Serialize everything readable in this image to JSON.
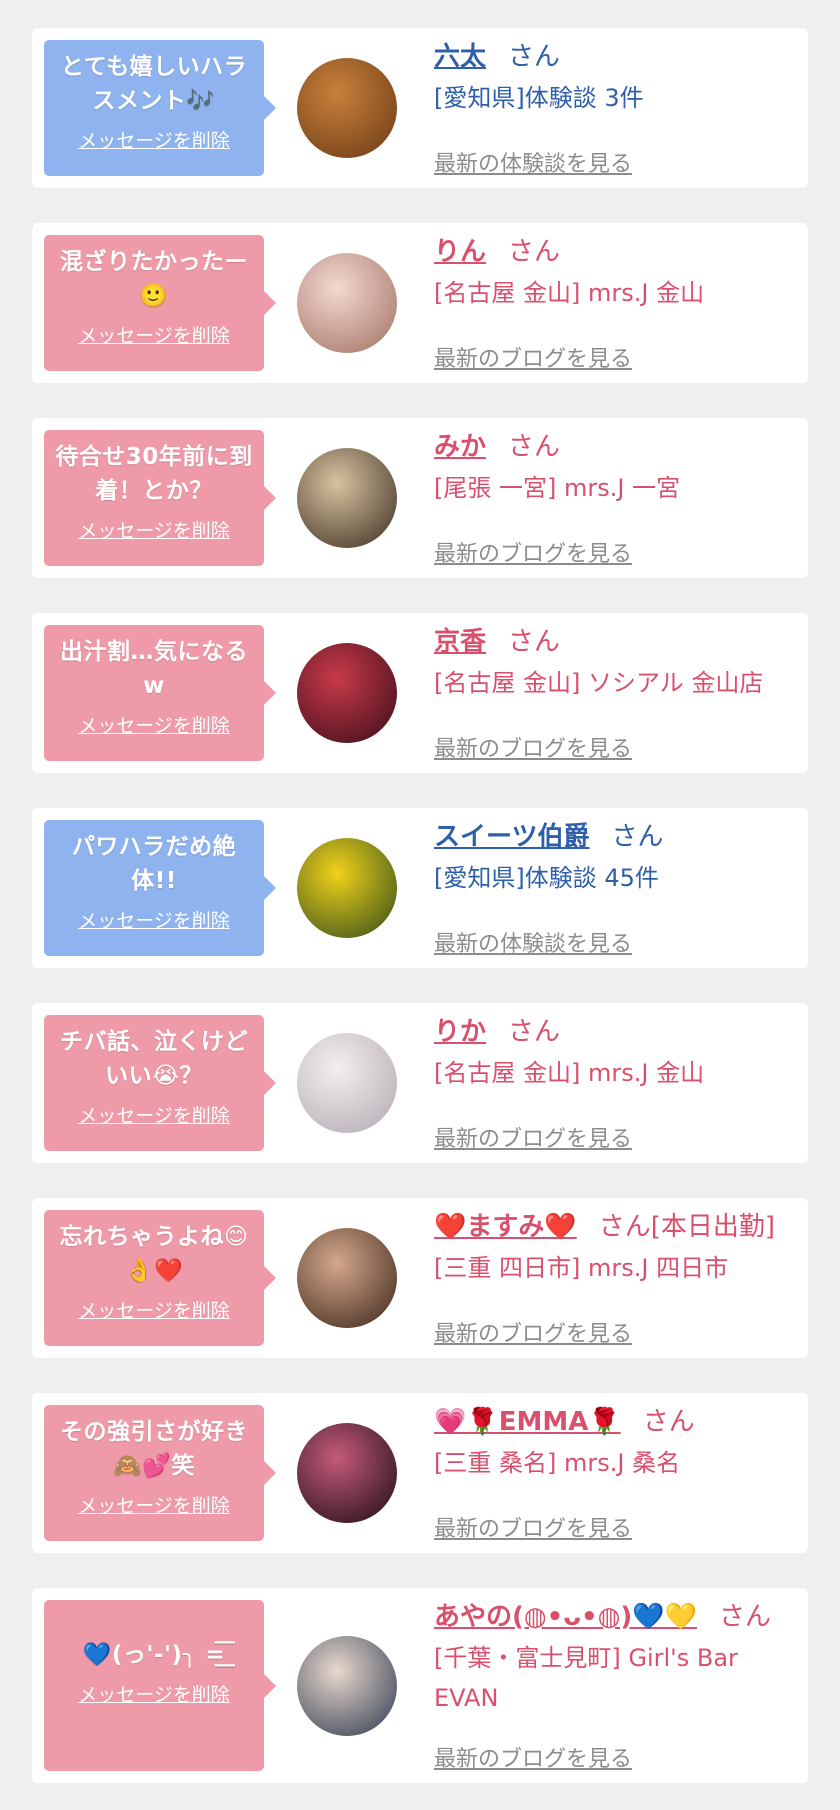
{
  "delete_label": "メッセージを削除",
  "san": "さん",
  "cards": [
    {
      "msg": "とても嬉しいハラスメント🎶",
      "name": "六太",
      "suffix": "",
      "sub": "[愛知県]体験談 3件",
      "latest": "最新の体験談を見る",
      "theme": "blue",
      "avatar_colors": [
        "#c9803b",
        "#6a3a15"
      ]
    },
    {
      "msg": "混ざりたかったー🙂",
      "name": "りん",
      "suffix": "",
      "sub": "[名古屋 金山] mrs.J 金山",
      "latest": "最新のブログを見る",
      "theme": "pink",
      "avatar_colors": [
        "#f4d8d2",
        "#a07060"
      ]
    },
    {
      "msg": "待合せ30年前に到着！とか？",
      "name": "みか",
      "suffix": "",
      "sub": "[尾張 一宮] mrs.J 一宮",
      "latest": "最新のブログを見る",
      "theme": "pink",
      "avatar_colors": [
        "#d8c2a0",
        "#3a2c20"
      ]
    },
    {
      "msg": "出汁割…気になるw",
      "name": "京香",
      "suffix": "",
      "sub": "[名古屋 金山] ソシアル 金山店",
      "latest": "最新のブログを見る",
      "theme": "pink",
      "avatar_colors": [
        "#c83a4a",
        "#3a0c18"
      ]
    },
    {
      "msg": "パワハラだめ絶体!!",
      "name": "スイーツ伯爵",
      "suffix": "",
      "sub": "[愛知県]体験談 45件",
      "latest": "最新の体験談を見る",
      "theme": "blue",
      "avatar_colors": [
        "#f2d21a",
        "#2d4a1a"
      ]
    },
    {
      "msg": "チバ話、泣くけどいい😭？",
      "name": "りか",
      "suffix": "",
      "sub": "[名古屋 金山] mrs.J 金山",
      "latest": "最新のブログを見る",
      "theme": "pink",
      "avatar_colors": [
        "#f4eef0",
        "#b0a8b0"
      ]
    },
    {
      "msg": "忘れちゃうよね😊👌❤️",
      "name": "❤️ますみ❤️",
      "suffix": "[本日出勤]",
      "sub": "[三重 四日市] mrs.J 四日市",
      "latest": "最新のブログを見る",
      "theme": "pink",
      "avatar_colors": [
        "#d4a88c",
        "#3a2418"
      ]
    },
    {
      "msg": "その強引さが好き🙈💕笑",
      "name": "💗🌹EMMA🌹",
      "suffix": "",
      "sub": "[三重 桑名] mrs.J 桑名",
      "latest": "最新のブログを見る",
      "theme": "pink",
      "avatar_colors": [
        "#c45a7a",
        "#1a0c12"
      ]
    },
    {
      "msg": "💙(っ'-')╮ =͟͟͞͞",
      "name": "あやの(◍•ᴗ•◍)💙💛",
      "suffix": "",
      "sub": "[千葉・富士見町] Girl's Bar EVAN",
      "latest": "最新のブログを見る",
      "theme": "pink",
      "avatar_colors": [
        "#e8d8cc",
        "#2c3850"
      ]
    }
  ]
}
